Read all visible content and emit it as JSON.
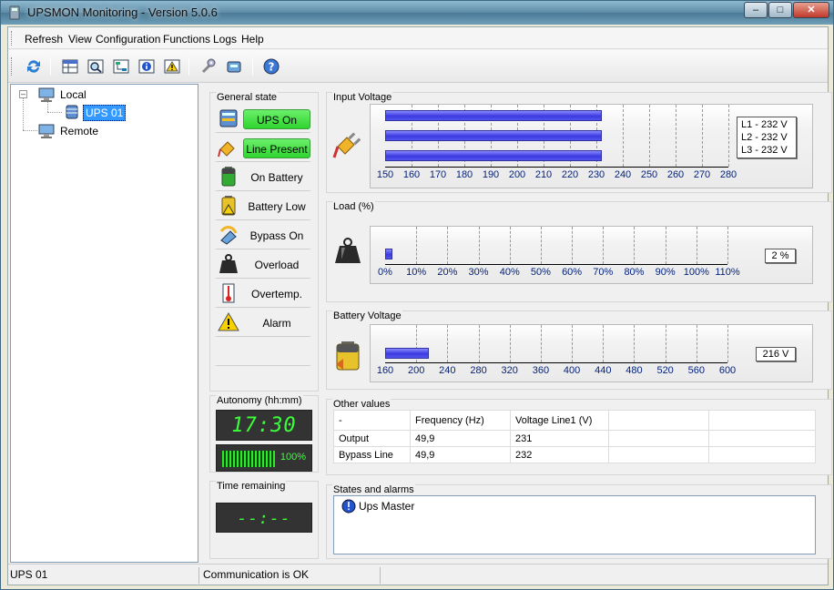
{
  "window": {
    "title": "UPSMON Monitoring - Version 5.0.6",
    "minimize": "–",
    "maximize": "□",
    "close": "✕"
  },
  "menu": [
    "Refresh",
    "View",
    "Configuration",
    "Functions",
    "Logs",
    "Help"
  ],
  "toolbar": {
    "icons": [
      "refresh-icon",
      "table-icon",
      "search-icon",
      "network-icon",
      "info-icon",
      "warning-icon",
      "tools-icon",
      "ups-icon",
      "help-icon"
    ]
  },
  "tree": {
    "local": "Local",
    "ups": "UPS 01",
    "remote": "Remote"
  },
  "general_state": {
    "title": "General state",
    "items": [
      {
        "label": "UPS On",
        "active": true,
        "icon": "ups-stack-icon"
      },
      {
        "label": "Line Present",
        "active": true,
        "icon": "plug-icon"
      },
      {
        "label": "On Battery",
        "active": false,
        "icon": "battery-icon"
      },
      {
        "label": "Battery Low",
        "active": false,
        "icon": "battery-low-icon"
      },
      {
        "label": "Bypass On",
        "active": false,
        "icon": "bypass-icon"
      },
      {
        "label": "Overload",
        "active": false,
        "icon": "weight-icon"
      },
      {
        "label": "Overtemp.",
        "active": false,
        "icon": "thermometer-icon"
      },
      {
        "label": "Alarm",
        "active": false,
        "icon": "alarm-icon"
      }
    ]
  },
  "autonomy": {
    "title": "Autonomy (hh:mm)",
    "value": "17:30",
    "charge_percent": 100,
    "charge_label": "100%"
  },
  "time_remaining": {
    "title": "Time remaining",
    "value": "--:--"
  },
  "input_voltage": {
    "title": "Input Voltage",
    "ticks": [
      "150",
      "160",
      "170",
      "180",
      "190",
      "200",
      "210",
      "220",
      "230",
      "240",
      "250",
      "260",
      "270",
      "280"
    ],
    "min": 150,
    "max": 280,
    "values": [
      232,
      232,
      232
    ],
    "readout": [
      "L1 - 232 V",
      "L2 - 232 V",
      "L3 - 232 V"
    ]
  },
  "load": {
    "title": "Load (%)",
    "ticks": [
      "0%",
      "10%",
      "20%",
      "30%",
      "40%",
      "50%",
      "60%",
      "70%",
      "80%",
      "90%",
      "100%",
      "110%"
    ],
    "min": 0,
    "max": 110,
    "value": 2,
    "readout": "2 %"
  },
  "battery_voltage": {
    "title": "Battery Voltage",
    "ticks": [
      "160",
      "200",
      "240",
      "280",
      "320",
      "360",
      "400",
      "440",
      "480",
      "520",
      "560",
      "600"
    ],
    "min": 160,
    "max": 600,
    "value": 216,
    "readout": "216 V"
  },
  "other_values": {
    "title": "Other values",
    "headers": [
      "-",
      "Frequency (Hz)",
      "Voltage Line1 (V)",
      "",
      ""
    ],
    "rows": [
      [
        "Output",
        "49,9",
        "231",
        "",
        ""
      ],
      [
        "Bypass Line",
        "49,9",
        "232",
        "",
        ""
      ]
    ]
  },
  "states_alarms": {
    "title": "States and alarms",
    "items": [
      "Ups Master"
    ]
  },
  "status": {
    "left": "UPS 01",
    "message": "Communication is OK"
  }
}
